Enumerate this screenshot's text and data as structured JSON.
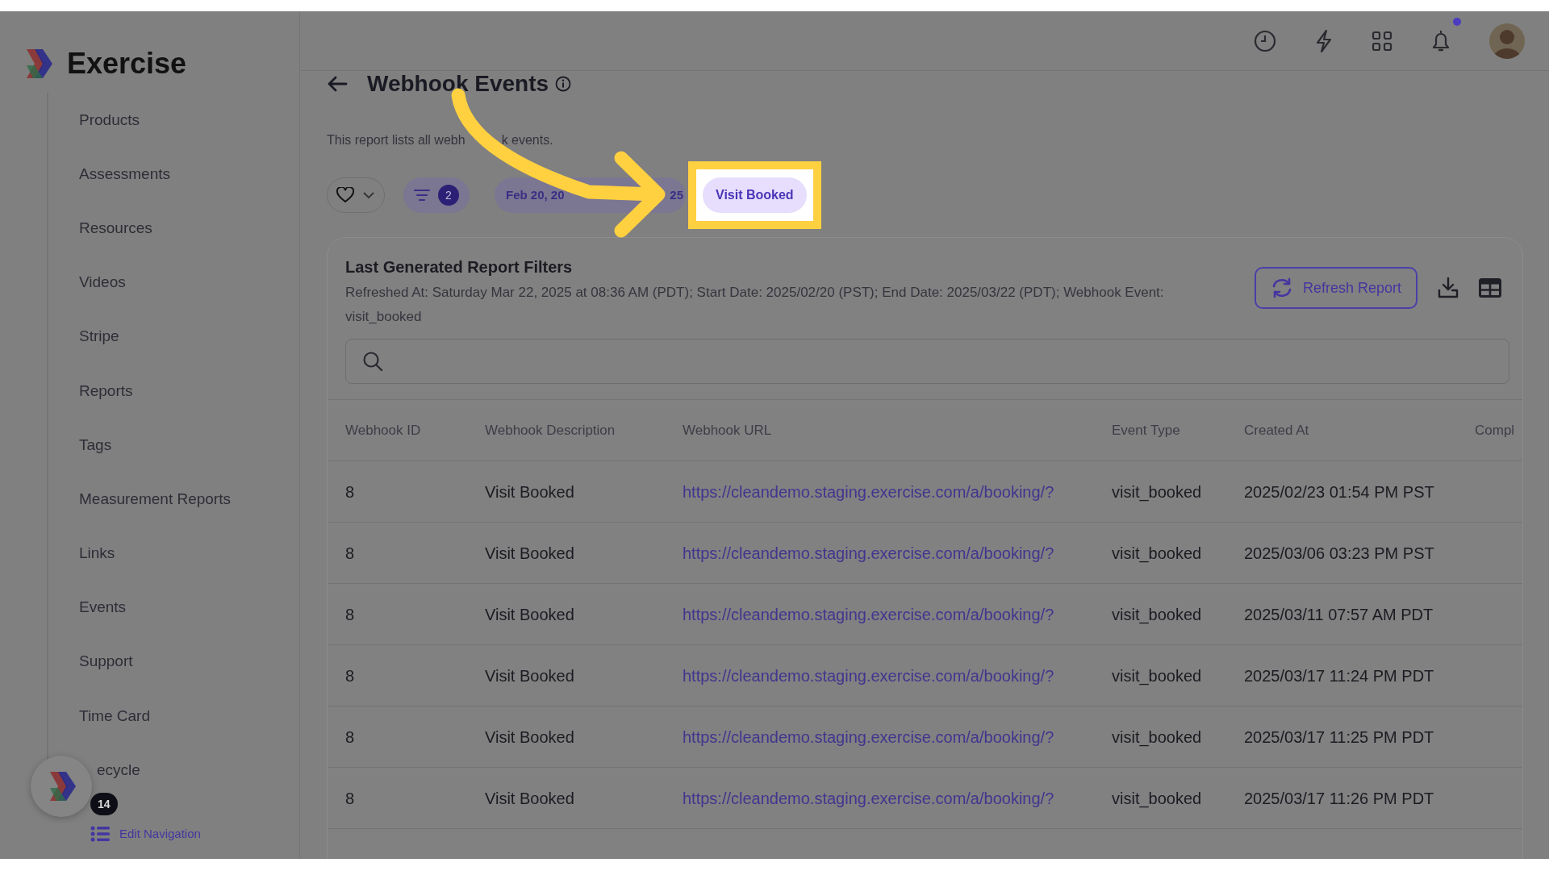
{
  "brand": {
    "name": "Exercise"
  },
  "top_bar": {
    "notifications_unread": true
  },
  "sidebar": {
    "items": [
      {
        "label": "Products"
      },
      {
        "label": "Assessments"
      },
      {
        "label": "Resources"
      },
      {
        "label": "Videos"
      },
      {
        "label": "Stripe"
      },
      {
        "label": "Reports"
      },
      {
        "label": "Tags"
      },
      {
        "label": "Measurement Reports"
      },
      {
        "label": "Links"
      },
      {
        "label": "Events"
      },
      {
        "label": "Support"
      },
      {
        "label": "Time Card"
      },
      {
        "label": "ecycle"
      }
    ],
    "launcher": {
      "badge": "14"
    },
    "edit_navigation": "Edit Navigation"
  },
  "page": {
    "title": "Webhook Events",
    "description_parts": [
      "This report lists all webh",
      "k events."
    ]
  },
  "filters": {
    "filter_count": "2",
    "date_chip_parts": [
      "Feb 20, 20",
      "25"
    ],
    "event_chip": {
      "label": "Visit Booked",
      "highlighted": true
    }
  },
  "report_card": {
    "title": "Last Generated Report Filters",
    "summary": "Refreshed At: Saturday Mar 22, 2025 at 08:36 AM (PDT); Start Date: 2025/02/20 (PST); End Date: 2025/03/22 (PDT); Webhook Event: visit_booked",
    "refresh_button": "Refresh Report"
  },
  "table": {
    "columns": [
      "Webhook ID",
      "Webhook Description",
      "Webhook URL",
      "Event Type",
      "Created At",
      "Compl"
    ],
    "rows": [
      [
        "8",
        "Visit Booked",
        "https://cleandemo.staging.exercise.com/a/booking/?",
        "visit_booked",
        "2025/02/23 01:54 PM PST"
      ],
      [
        "8",
        "Visit Booked",
        "https://cleandemo.staging.exercise.com/a/booking/?",
        "visit_booked",
        "2025/03/06 03:23 PM PST"
      ],
      [
        "8",
        "Visit Booked",
        "https://cleandemo.staging.exercise.com/a/booking/?",
        "visit_booked",
        "2025/03/11 07:57 AM PDT"
      ],
      [
        "8",
        "Visit Booked",
        "https://cleandemo.staging.exercise.com/a/booking/?",
        "visit_booked",
        "2025/03/17 11:24 PM PDT"
      ],
      [
        "8",
        "Visit Booked",
        "https://cleandemo.staging.exercise.com/a/booking/?",
        "visit_booked",
        "2025/03/17 11:25 PM PDT"
      ],
      [
        "8",
        "Visit Booked",
        "https://cleandemo.staging.exercise.com/a/booking/?",
        "visit_booked",
        "2025/03/17 11:26 PM PDT"
      ]
    ]
  }
}
